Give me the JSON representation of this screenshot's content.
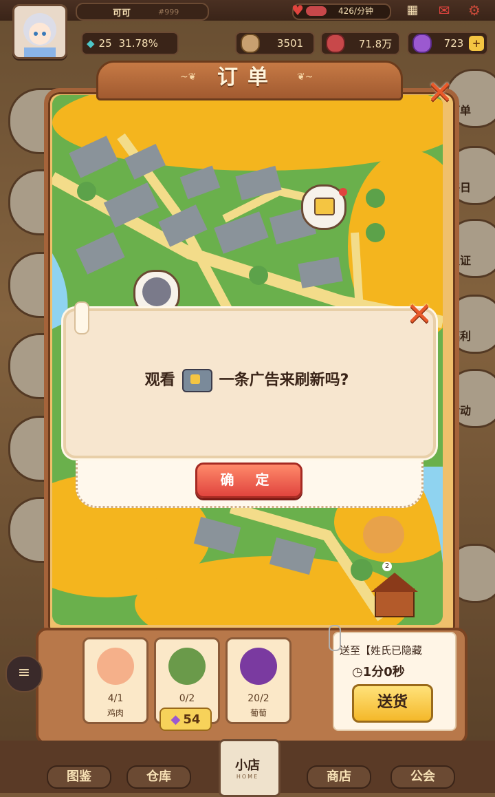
{
  "topbar": {
    "player_name": "可可",
    "player_id": "#999",
    "income_rate": "426/分钟",
    "gem_level_value": "25",
    "gem_level_pct": "31.78%",
    "coins": "3501",
    "hearts": "71.8万",
    "gems": "723",
    "plus_label": "+"
  },
  "side_right": {
    "order": "订单",
    "daily": "每日",
    "verify": "认证",
    "welfare": "福利",
    "activity": "活动"
  },
  "panel": {
    "title": "订单",
    "map_marker_badge": "2"
  },
  "dialog": {
    "text_before": "观看",
    "text_after": "一条广告来刷新吗?",
    "confirm_label": "确 定"
  },
  "order_items": [
    {
      "icon": "chicken-icon",
      "count": "4/1",
      "name": "鸡肉"
    },
    {
      "icon": "crab-sack-icon",
      "count": "0/2",
      "name": ""
    },
    {
      "icon": "grape-icon",
      "count": "20/2",
      "name": "葡萄"
    }
  ],
  "gem_cost": "54",
  "shipment": {
    "to": "送至【姓氏已隐藏",
    "time": "1分0秒",
    "ship_label": "送货"
  },
  "bottom_nav": {
    "catalog": "图鉴",
    "warehouse": "仓库",
    "home": "小店",
    "home_sub": "HOME",
    "shop": "商店",
    "guild": "公会"
  },
  "colors": {
    "accent_red": "#e0443e",
    "panel_border": "#a5633a",
    "gem_purple": "#9b59d0",
    "gold": "#f4c542"
  }
}
